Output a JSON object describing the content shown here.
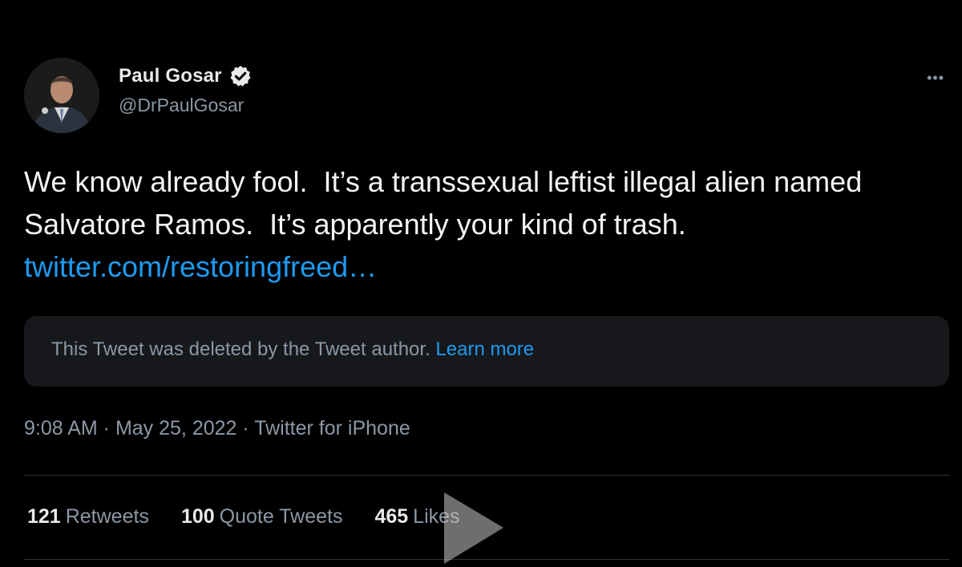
{
  "author": {
    "display_name": "Paul Gosar",
    "handle": "@DrPaulGosar",
    "verified": true
  },
  "tweet": {
    "text": "We know already fool.  It’s a transsexual leftist illegal alien named Salvatore Ramos.  It’s apparently your kind of trash. ",
    "link_text": "twitter.com/restoringfreed…"
  },
  "quote": {
    "deleted_text": "This Tweet was deleted by the Tweet author.",
    "learn_more": "Learn more"
  },
  "meta": {
    "time": "9:08 AM",
    "date": "May 25, 2022",
    "source": "Twitter for iPhone",
    "separator": " · "
  },
  "stats": [
    {
      "count": "121",
      "label": "Retweets"
    },
    {
      "count": "100",
      "label": "Quote Tweets"
    },
    {
      "count": "465",
      "label": "Likes"
    }
  ],
  "icons": {
    "more": "more-icon",
    "verified": "verified-badge-icon",
    "play": "play-icon"
  },
  "colors": {
    "background": "#000000",
    "link": "#1d9bf0",
    "secondary_text": "#8b98a5",
    "primary_text": "#e7e9ea"
  }
}
